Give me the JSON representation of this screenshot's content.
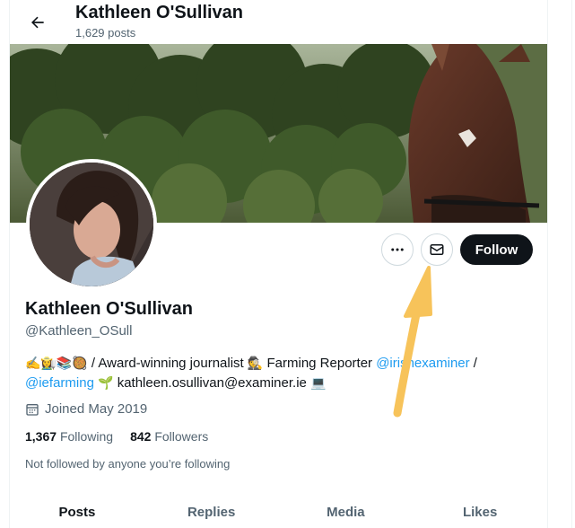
{
  "header": {
    "title": "Kathleen O'Sullivan",
    "post_count": "1,629 posts"
  },
  "profile": {
    "name": "Kathleen O'Sullivan",
    "handle": "@Kathleen_OSull",
    "bio": {
      "emojis_lead": "✍️👩‍🌾📚🥘",
      "text1": " / Award-winning journalist ",
      "emoji_detective": "🕵️",
      "text2": " Farming Reporter ",
      "mention1": "@irishexaminer",
      "text3": " /",
      "mention2": "@iefarming",
      "emoji_seedling": "🌱",
      "email": " kathleen.osullivan@examiner.ie ",
      "emoji_computer": "💻"
    },
    "joined": "Joined May 2019",
    "following_count": "1,367",
    "following_label": "Following",
    "followers_count": "842",
    "followers_label": "Followers",
    "not_followed": "Not followed by anyone you’re following"
  },
  "actions": {
    "follow_label": "Follow"
  },
  "tabs": [
    {
      "label": "Posts",
      "active": true
    },
    {
      "label": "Replies",
      "active": false
    },
    {
      "label": "Media",
      "active": false
    },
    {
      "label": "Likes",
      "active": false
    }
  ],
  "icons": {
    "back": "arrow-left-icon",
    "more": "more-horizontal-icon",
    "message": "envelope-icon",
    "calendar": "calendar-icon"
  },
  "colors": {
    "primary_text": "#0f1419",
    "secondary_text": "#536471",
    "link": "#1d9bf0",
    "follow_bg": "#0f1419",
    "annotation_arrow": "#f7c35a"
  }
}
